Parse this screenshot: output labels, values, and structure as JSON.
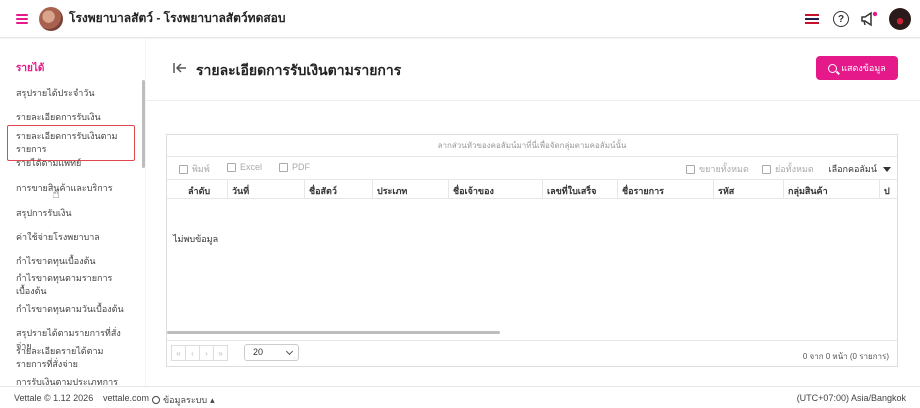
{
  "app": {
    "title": "โรงพยาบาลสัตว์ - โรงพยาบาลสัตว์ทดสอบ"
  },
  "header_icons": {
    "flag": "thailand-flag-icon",
    "help": "?",
    "notifications": "megaphone-icon",
    "profile": "avatar"
  },
  "sidebar": {
    "heading": "รายได้",
    "items": [
      {
        "label": "สรุปรายได้ประจำวัน"
      },
      {
        "label": "รายละเอียดการรับเงิน"
      },
      {
        "label": "รายละเอียดการรับเงินตามรายการ"
      },
      {
        "label": "รายได้ตามแพทย์"
      },
      {
        "label": "การขายสินค้าและบริการ"
      },
      {
        "label": "สรุปการรับเงิน"
      },
      {
        "label": "ค่าใช้จ่ายโรงพยาบาล"
      },
      {
        "label": "กำไรขาดทุนเบื้องต้น"
      },
      {
        "label": "กำไรขาดทุนตามรายการเบื้องต้น"
      },
      {
        "label": "กำไรขาดทุนตามวันเบื้องต้น"
      },
      {
        "label": "สรุปรายได้ตามรายการที่สั่งจ่าย"
      },
      {
        "label": "รายละเอียดรายได้ตามรายการที่สั่งจ่าย"
      },
      {
        "label": "การรับเงินตามประเภทการชำระ"
      }
    ]
  },
  "page": {
    "title": "รายละเอียดการรับเงินตามรายการ",
    "show_button": "แสดงข้อมูล"
  },
  "grid": {
    "group_panel_hint": "ลากส่วนหัวของคอลัมน์มาที่นี่เพื่อจัดกลุ่มตามคอลัมน์นั้น",
    "toolbar": {
      "print": "พิมพ์",
      "excel": "Excel",
      "pdf": "PDF",
      "expand_all": "ขยายทั้งหมด",
      "collapse_all": "ย่อทั้งหมด",
      "column_chooser": "เลือกคอลัมน์"
    },
    "columns": [
      "ลำดับ",
      "วันที่",
      "ชื่อสัตว์",
      "ประเภท",
      "ชื่อเจ้าของ",
      "เลขที่ใบเสร็จ",
      "ชื่อรายการ",
      "รหัส",
      "กลุ่มสินค้า",
      "ป"
    ],
    "no_data": "ไม่พบข้อมูล",
    "pager": {
      "nav": [
        "«",
        "‹",
        "›",
        "»"
      ],
      "page_size": "20",
      "info": "0 จาก 0 หน้า (0 รายการ)"
    }
  },
  "footer": {
    "version": "Vettale © 1.12 2026",
    "site": "vettale.com",
    "system_info": "ข้อมูลระบบ",
    "timezone": "(UTC+07:00) Asia/Bangkok"
  },
  "colors": {
    "accent": "#e6198a",
    "active_border": "#e0484f"
  }
}
